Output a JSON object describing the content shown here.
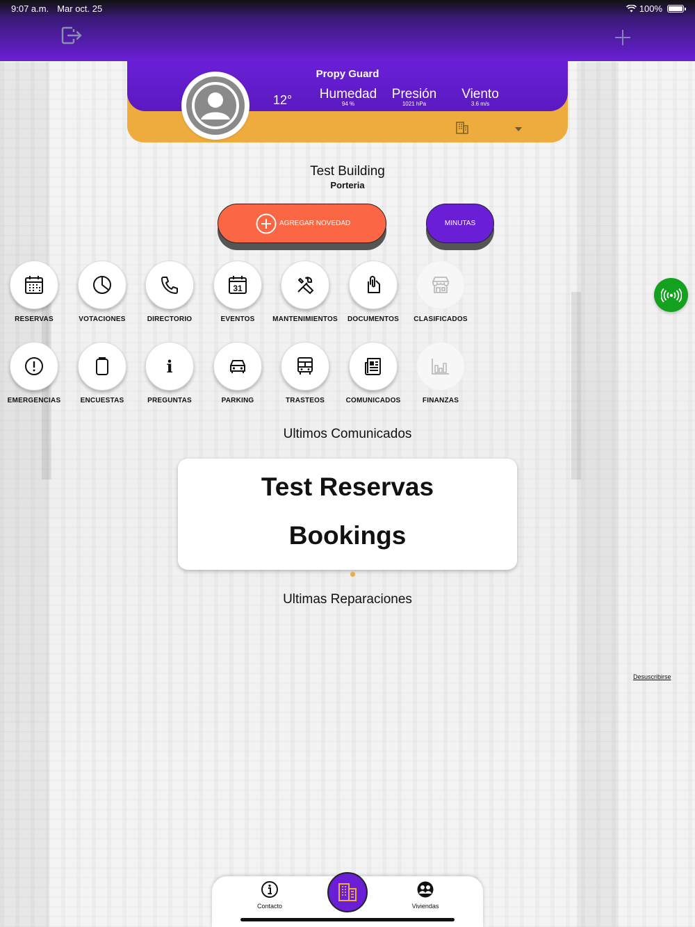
{
  "status_bar": {
    "time": "9:07 a.m.",
    "date": "Mar oct. 25",
    "battery": "100%"
  },
  "header": {
    "logout_icon": "logout-icon",
    "add_icon": "plus-icon"
  },
  "weather": {
    "title": "Propy Guard",
    "temperature": "12°",
    "humidity_label": "Humedad",
    "humidity_value": "94 %",
    "pressure_label": "Presión",
    "pressure_value": "1021 hPa",
    "wind_label": "Viento",
    "wind_value": "3.6 m/s"
  },
  "building": {
    "name": "Test Building",
    "subtitle": "Porteria"
  },
  "actions": {
    "add_novedad": "AGREGAR NOVEDAD",
    "minutas": "MINUTAS"
  },
  "menu": {
    "row1": [
      {
        "label": "RESERVAS",
        "icon": "calendar-icon"
      },
      {
        "label": "VOTACIONES",
        "icon": "pie-chart-icon"
      },
      {
        "label": "DIRECTORIO",
        "icon": "phone-icon"
      },
      {
        "label": "EVENTOS",
        "icon": "calendar-31-icon",
        "day": "31"
      },
      {
        "label": "MANTENIMIENTOS",
        "icon": "tools-icon"
      },
      {
        "label": "DOCUMENTOS",
        "icon": "paperclip-doc-icon"
      },
      {
        "label": "CLASIFICADOS",
        "icon": "store-icon"
      }
    ],
    "row2": [
      {
        "label": "EMERGENCIAS",
        "icon": "alert-circle-icon"
      },
      {
        "label": "ENCUESTAS",
        "icon": "clipboard-icon"
      },
      {
        "label": "PREGUNTAS",
        "icon": "info-icon",
        "glyph": "i"
      },
      {
        "label": "PARKING",
        "icon": "car-icon"
      },
      {
        "label": "TRASTEOS",
        "icon": "truck-icon"
      },
      {
        "label": "COMUNICADOS",
        "icon": "newspaper-icon"
      },
      {
        "label": "FINANZAS",
        "icon": "bar-chart-icon"
      }
    ]
  },
  "sections": {
    "communications_title": "Ultimos Comunicados",
    "repairs_title": "Ultimas Reparaciones"
  },
  "communication_card": {
    "line1": "Test Reservas",
    "line2": "Bookings"
  },
  "unsubscribe": "Desuscribirse",
  "tabbar": {
    "contact": "Contacto",
    "homes": "Viviendas"
  },
  "colors": {
    "purple": "#6a1fd6",
    "orange": "#eeab3e",
    "coral": "#fb6745",
    "green": "#15a120"
  }
}
